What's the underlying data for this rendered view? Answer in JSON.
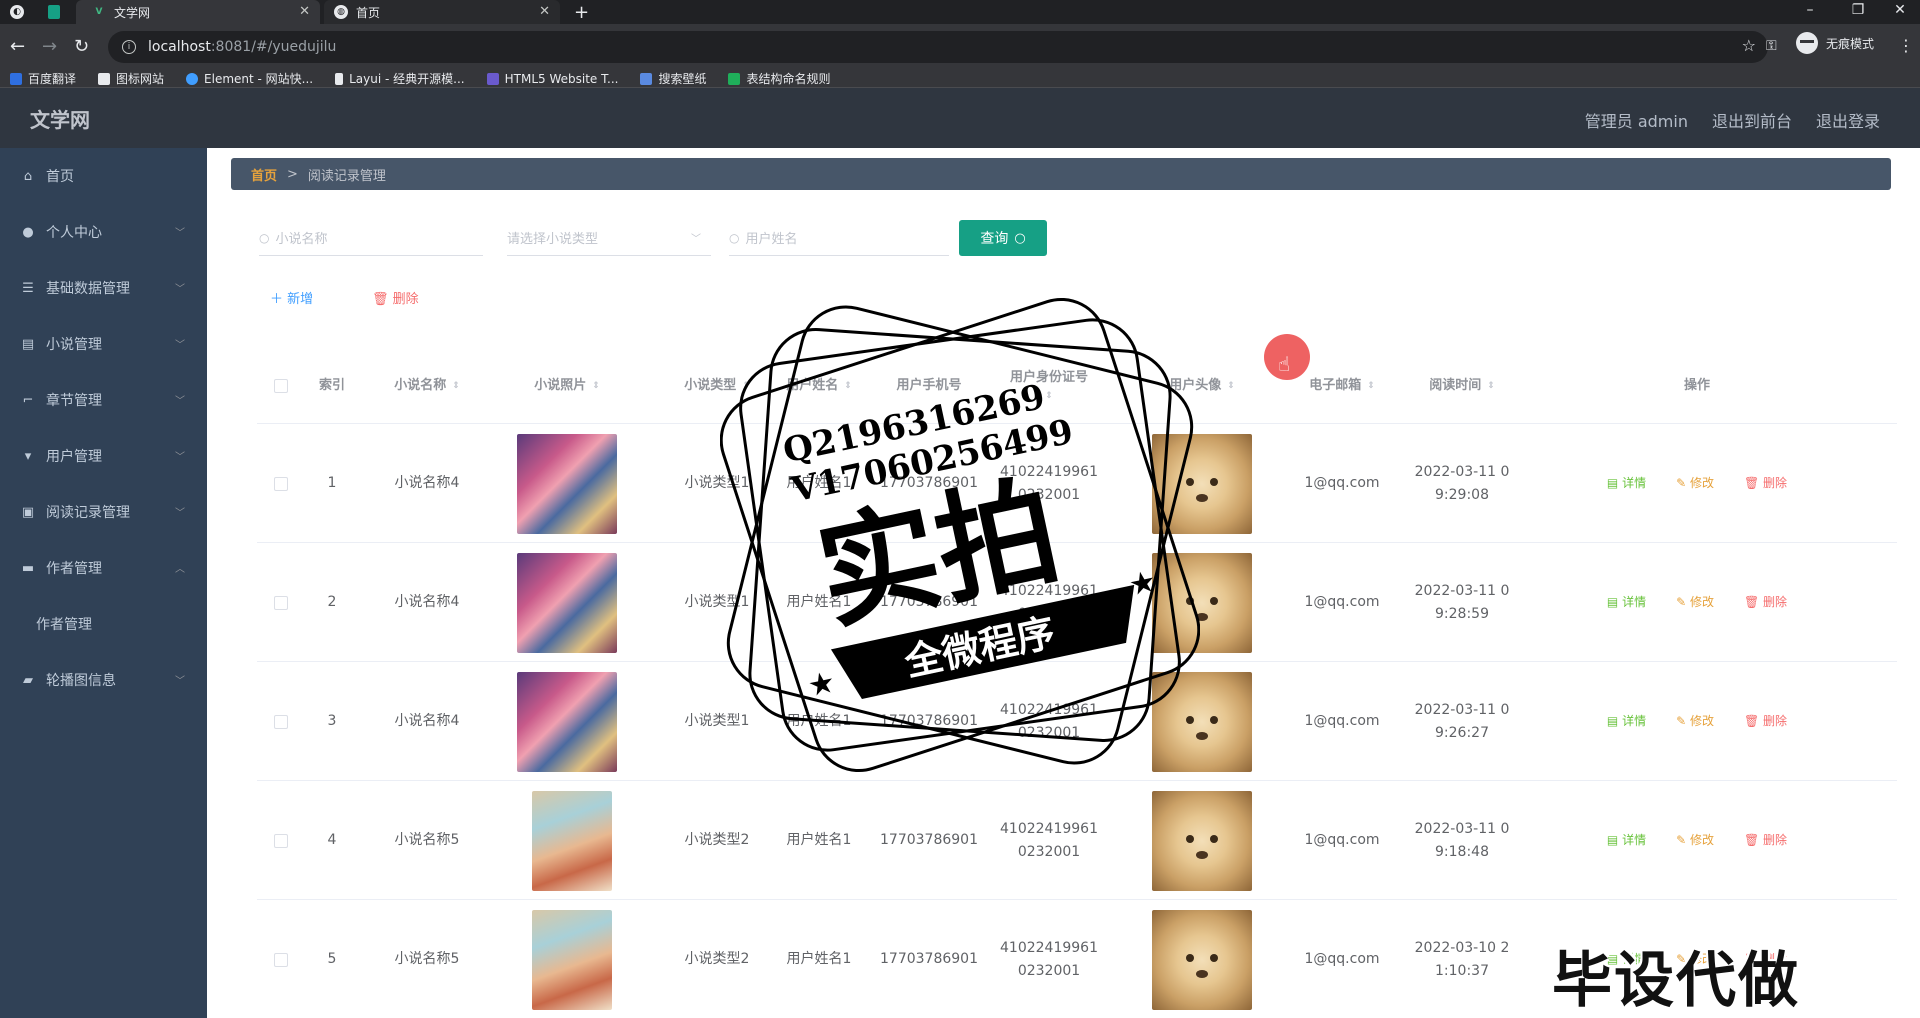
{
  "browser": {
    "tabs": [
      {
        "title": "文学网",
        "active": true
      },
      {
        "title": "首页",
        "active": false
      }
    ],
    "new_tab": "+",
    "url_host": "localhost",
    "url_rest": ":8081/#/yuedujilu",
    "incognito": "无痕模式",
    "bookmarks": [
      "百度翻译",
      "图标网站",
      "Element - 网站快...",
      "Layui - 经典开源模...",
      "HTML5 Website T...",
      "搜索壁纸",
      "表结构命名规则"
    ]
  },
  "header": {
    "logo": "文学网",
    "admin": "管理员 admin",
    "to_front": "退出到前台",
    "logout": "退出登录"
  },
  "sidebar": {
    "items": [
      {
        "label": "首页",
        "icon": "home-icon"
      },
      {
        "label": "个人中心",
        "icon": "user-icon"
      },
      {
        "label": "基础数据管理",
        "icon": "list-icon"
      },
      {
        "label": "小说管理",
        "icon": "book-icon"
      },
      {
        "label": "章节管理",
        "icon": "crop-icon"
      },
      {
        "label": "用户管理",
        "icon": "stamp-icon"
      },
      {
        "label": "阅读记录管理",
        "icon": "record-icon"
      },
      {
        "label": "作者管理",
        "icon": "chat-icon"
      },
      {
        "label": "作者管理",
        "icon": ""
      },
      {
        "label": "轮播图信息",
        "icon": "slides-icon"
      }
    ]
  },
  "breadcrumb": {
    "home": "首页",
    "sep": ">",
    "current": "阅读记录管理"
  },
  "search": {
    "novel_name_placeholder": "小说名称",
    "novel_type_placeholder": "请选择小说类型",
    "user_name_placeholder": "用户姓名",
    "query_label": "查询"
  },
  "actions": {
    "add": "新增",
    "delete": "删除"
  },
  "table": {
    "headers": [
      "索引",
      "小说名称",
      "小说照片",
      "小说类型",
      "用户姓名",
      "用户手机号",
      "用户身份证号",
      "用户头像",
      "电子邮箱",
      "阅读时间",
      "操作"
    ],
    "op_labels": {
      "detail": "详情",
      "edit": "修改",
      "delete": "删除"
    },
    "rows": [
      {
        "index": "1",
        "name": "小说名称4",
        "type": "小说类型1",
        "user": "用户姓名1",
        "phone": "17703786901",
        "id1": "41022419961",
        "id2": "0232001",
        "email": "1@qq.com",
        "time1": "2022-03-11 0",
        "time2": "9:29:08",
        "cover": "a"
      },
      {
        "index": "2",
        "name": "小说名称4",
        "type": "小说类型1",
        "user": "用户姓名1",
        "phone": "17703786901",
        "id1": "41022419961",
        "id2": "0232001",
        "email": "1@qq.com",
        "time1": "2022-03-11 0",
        "time2": "9:28:59",
        "cover": "a"
      },
      {
        "index": "3",
        "name": "小说名称4",
        "type": "小说类型1",
        "user": "用户姓名1",
        "phone": "17703786901",
        "id1": "41022419961",
        "id2": "0232001",
        "email": "1@qq.com",
        "time1": "2022-03-11 0",
        "time2": "9:26:27",
        "cover": "a"
      },
      {
        "index": "4",
        "name": "小说名称5",
        "type": "小说类型2",
        "user": "用户姓名1",
        "phone": "17703786901",
        "id1": "41022419961",
        "id2": "0232001",
        "email": "1@qq.com",
        "time1": "2022-03-11 0",
        "time2": "9:18:48",
        "cover": "b"
      },
      {
        "index": "5",
        "name": "小说名称5",
        "type": "小说类型2",
        "user": "用户姓名1",
        "phone": "17703786901",
        "id1": "41022419961",
        "id2": "0232001",
        "email": "1@qq.com",
        "time1": "2022-03-10 2",
        "time2": "1:10:37",
        "cover": "b"
      }
    ]
  },
  "watermark": {
    "line1": "Q2196316269",
    "line2": "V17060256499",
    "big": "实拍",
    "banner": "全微程序",
    "bottom": "毕设代做"
  },
  "colors": {
    "primary": "#16a085",
    "sidebar": "#304156",
    "header": "#2f3640",
    "danger": "#f56c6c",
    "warning": "#e6a23c",
    "success": "#67c23a",
    "link": "#409eff"
  }
}
